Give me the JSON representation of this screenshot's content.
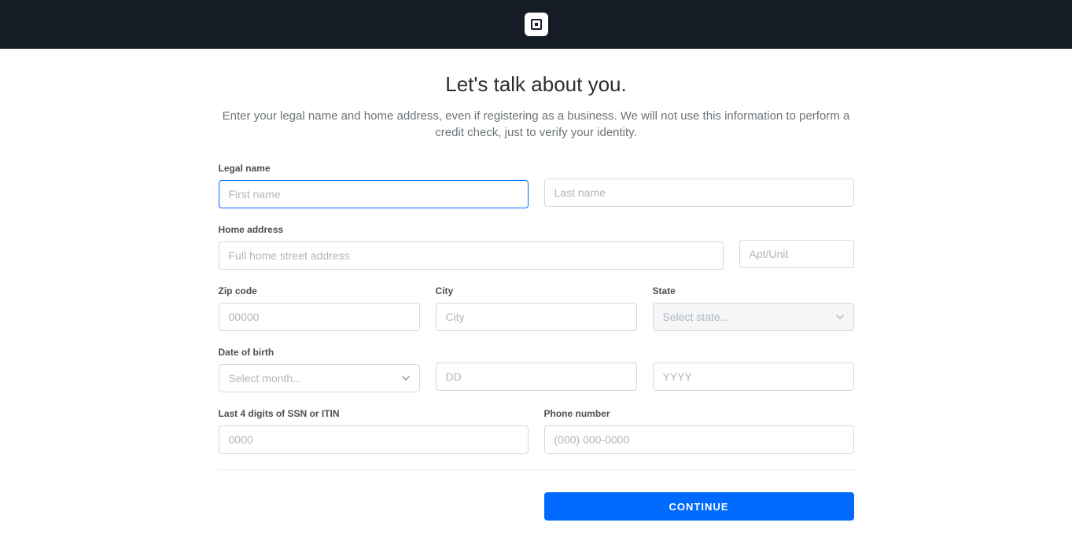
{
  "page": {
    "title": "Let's talk about you.",
    "subtitle": "Enter your legal name and home address, even if registering as a business. We will not use this information to perform a credit check, just to verify your identity."
  },
  "labels": {
    "legal_name": "Legal name",
    "home_address": "Home address",
    "zip_code": "Zip code",
    "city": "City",
    "state": "State",
    "date_of_birth": "Date of birth",
    "ssn": "Last 4 digits of SSN or ITIN",
    "phone": "Phone number"
  },
  "placeholders": {
    "first_name": "First name",
    "last_name": "Last name",
    "street": "Full home street address",
    "apt": "Apt/Unit",
    "zip": "00000",
    "city": "City",
    "state": "Select state...",
    "month": "Select month...",
    "day": "DD",
    "year": "YYYY",
    "ssn": "0000",
    "phone": "(000) 000-0000"
  },
  "buttons": {
    "continue": "CONTINUE"
  },
  "values": {
    "first_name": "",
    "last_name": "",
    "street": "",
    "apt": "",
    "zip": "",
    "city": "",
    "state": "",
    "month": "",
    "day": "",
    "year": "",
    "ssn": "",
    "phone": ""
  }
}
